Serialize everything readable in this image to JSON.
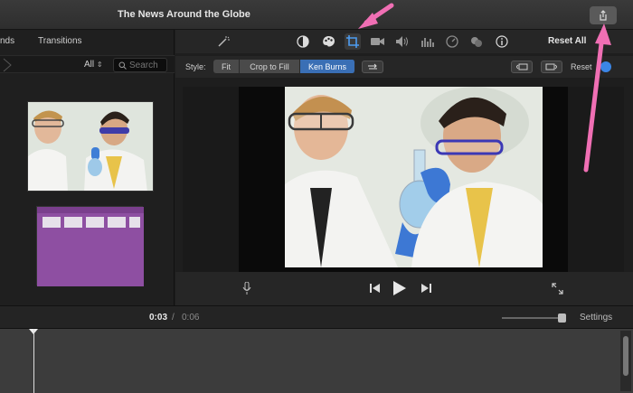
{
  "window": {
    "title": "The News Around the Globe"
  },
  "left_panel": {
    "tabs": [
      "nds",
      "Transitions"
    ],
    "filter": {
      "all_label": "All",
      "search_placeholder": "Search"
    }
  },
  "toolbar": {
    "icons": [
      "magic-wand-icon",
      "color-balance-icon",
      "color-palette-icon",
      "crop-icon",
      "camera-icon",
      "volume-icon",
      "equalizer-icon",
      "speed-icon",
      "noise-reduction-icon",
      "info-icon"
    ],
    "reset_all_label": "Reset All"
  },
  "style_bar": {
    "label": "Style:",
    "segments": [
      "Fit",
      "Crop to Fill",
      "Ken Burns"
    ],
    "selected": "Ken Burns",
    "reset_label": "Reset"
  },
  "playback": {
    "current_time": "0:03",
    "separator": "/",
    "total_time": "0:06",
    "settings_label": "Settings"
  },
  "colors": {
    "accent": "#3a6fb5",
    "annotation_arrow": "#f06fb4"
  }
}
